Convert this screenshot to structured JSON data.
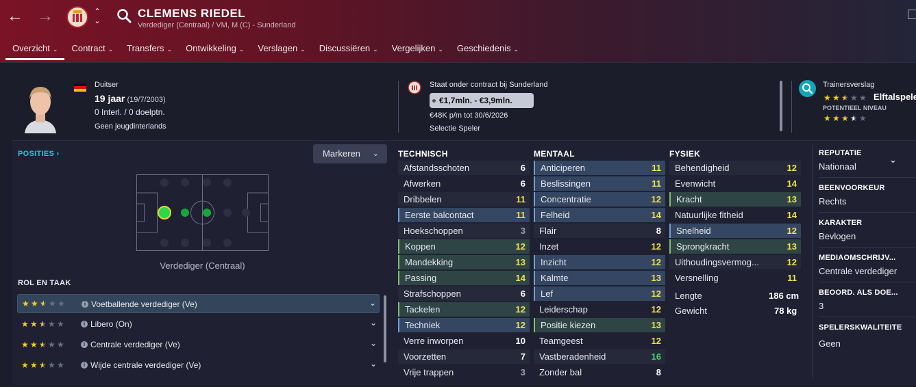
{
  "header": {
    "name": "CLEMENS RIEDEL",
    "subtitle": "Verdediger (Centraal) / VM, M (C) - Sunderland"
  },
  "tabs": [
    {
      "label": "Overzicht",
      "active": true
    },
    {
      "label": "Contract"
    },
    {
      "label": "Transfers"
    },
    {
      "label": "Ontwikkeling"
    },
    {
      "label": "Verslagen"
    },
    {
      "label": "Discussiëren"
    },
    {
      "label": "Vergelijken"
    },
    {
      "label": "Geschiedenis"
    }
  ],
  "bio": {
    "nationality": "Duitser",
    "age": "19 jaar",
    "dob": "(19/7/2003)",
    "caps": "0 Interl. / 0 doelptn.",
    "youth": "Geen jeugdinterlands"
  },
  "contract": {
    "status": "Staat onder contract bij Sunderland",
    "value": "€1,7mln. - €3,9mln.",
    "wage": "€48K p/m tot 30/6/2026",
    "selection": "Selectie Speler"
  },
  "scout": {
    "title": "Trainersverslag",
    "current_label": "Elftalspeler",
    "potential_label": "POTENTIEEL NIVEAU",
    "current_stars": 2.5,
    "potential_stars": 3.5
  },
  "positions": {
    "title": "POSITIES",
    "mark_button": "Markeren",
    "label": "Verdediger (Centraal)"
  },
  "roles": {
    "title": "ROL EN TAAK",
    "items": [
      {
        "label": "Voetballende verdediger (Ve)",
        "stars": 2.5,
        "selected": true
      },
      {
        "label": "Libero (On)",
        "stars": 2.5
      },
      {
        "label": "Centrale verdediger (Ve)",
        "stars": 2.5
      },
      {
        "label": "Wijde centrale verdediger (Ve)",
        "stars": 2.5
      }
    ]
  },
  "technical": {
    "title": "TECHNISCH",
    "items": [
      {
        "name": "Afstandsschoten",
        "value": "6"
      },
      {
        "name": "Afwerken",
        "value": "6"
      },
      {
        "name": "Dribbelen",
        "value": "11"
      },
      {
        "name": "Eerste balcontact",
        "value": "11",
        "hl": "blue"
      },
      {
        "name": "Hoekschoppen",
        "value": "3"
      },
      {
        "name": "Koppen",
        "value": "12",
        "hl": "green"
      },
      {
        "name": "Mandekking",
        "value": "13",
        "hl": "green"
      },
      {
        "name": "Passing",
        "value": "14",
        "hl": "green"
      },
      {
        "name": "Strafschoppen",
        "value": "6"
      },
      {
        "name": "Tackelen",
        "value": "12",
        "hl": "green"
      },
      {
        "name": "Techniek",
        "value": "12",
        "hl": "blue"
      },
      {
        "name": "Verre inworpen",
        "value": "10"
      },
      {
        "name": "Voorzetten",
        "value": "7"
      },
      {
        "name": "Vrije trappen",
        "value": "3"
      }
    ]
  },
  "mental": {
    "title": "MENTAAL",
    "items": [
      {
        "name": "Anticiperen",
        "value": "11",
        "hl": "blue"
      },
      {
        "name": "Beslissingen",
        "value": "11",
        "hl": "blue"
      },
      {
        "name": "Concentratie",
        "value": "12",
        "hl": "blue"
      },
      {
        "name": "Felheid",
        "value": "14",
        "hl": "blue"
      },
      {
        "name": "Flair",
        "value": "8"
      },
      {
        "name": "Inzet",
        "value": "12"
      },
      {
        "name": "Inzicht",
        "value": "12",
        "hl": "blue"
      },
      {
        "name": "Kalmte",
        "value": "13",
        "hl": "blue"
      },
      {
        "name": "Lef",
        "value": "12",
        "hl": "blue"
      },
      {
        "name": "Leiderschap",
        "value": "12"
      },
      {
        "name": "Positie kiezen",
        "value": "13",
        "hl": "green"
      },
      {
        "name": "Teamgeest",
        "value": "12"
      },
      {
        "name": "Vastberadenheid",
        "value": "16"
      },
      {
        "name": "Zonder bal",
        "value": "8"
      }
    ]
  },
  "physical": {
    "title": "FYSIEK",
    "items": [
      {
        "name": "Behendigheid",
        "value": "12"
      },
      {
        "name": "Evenwicht",
        "value": "14"
      },
      {
        "name": "Kracht",
        "value": "13",
        "hl": "green"
      },
      {
        "name": "Natuurlijke fitheid",
        "value": "14"
      },
      {
        "name": "Snelheid",
        "value": "12",
        "hl": "blue"
      },
      {
        "name": "Sprongkracht",
        "value": "13",
        "hl": "green"
      },
      {
        "name": "Uithoudingsvermog...",
        "value": "12"
      },
      {
        "name": "Versnelling",
        "value": "11"
      }
    ],
    "height_label": "Lengte",
    "height": "186 cm",
    "weight_label": "Gewicht",
    "weight": "78 kg"
  },
  "side": [
    {
      "h": "REPUTATIE",
      "v": "Nationaal"
    },
    {
      "h": "BEENVOORKEUR",
      "v": "Rechts"
    },
    {
      "h": "KARAKTER",
      "v": "Bevlogen"
    },
    {
      "h": "MEDIAOMSCHRIJV...",
      "v": "Centrale verdediger"
    },
    {
      "h": "BEOORD. ALS DOE...",
      "v": "3"
    },
    {
      "h": "SPELERSKWALITEITE",
      "v": "Geen"
    }
  ]
}
